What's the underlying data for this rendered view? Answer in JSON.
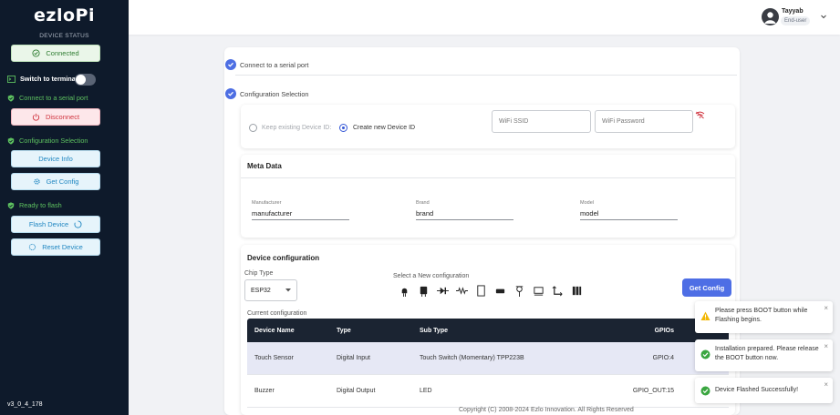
{
  "sidebar": {
    "logo": "ezloPi",
    "device_status": "DEVICE STATUS",
    "connected": "Connected",
    "switch_terminal": "Switch to terminal",
    "step1": "Connect to a serial port",
    "disconnect": "Disconnect",
    "step2": "Configuration Selection",
    "device_info": "Device Info",
    "get_config": "Get Config",
    "step3": "Ready to flash",
    "flash_device": "Flash Device",
    "reset_device": "Reset Device",
    "version": "v3_0_4_178"
  },
  "user": {
    "name": "Tayyab",
    "role": "End-user"
  },
  "steps": {
    "connect": "Connect to a serial port",
    "config": "Configuration Selection"
  },
  "device_id": {
    "keep": "Keep existing Device ID:",
    "create": "Create new Device ID",
    "wifi_ssid": "WiFi SSID",
    "wifi_password": "WiFi Password"
  },
  "meta": {
    "title": "Meta Data",
    "manufacturer_label": "Manufacturer",
    "manufacturer": "manufacturer",
    "brand_label": "Brand",
    "brand": "brand",
    "model_label": "Model",
    "model": "model"
  },
  "device_config": {
    "title": "Device configuration",
    "chip_type_label": "Chip Type",
    "chip_type": "ESP32",
    "new_config_label": "Select a New configuration",
    "get_config": "Get Config",
    "current_config_label": "Current configuration",
    "columns": [
      "Device Name",
      "Type",
      "Sub Type",
      "GPIOs"
    ],
    "rows": [
      [
        "Touch Sensor",
        "Digital Input",
        "Touch Switch (Momentary) TPP223B",
        "GPIO:4"
      ],
      [
        "Buzzer",
        "Digital Output",
        "LED",
        "GPIO_OUT:15"
      ]
    ]
  },
  "footer": "Copyright (C) 2008-2024 Ezlo Innovation. All Rights Reserved",
  "toasts": [
    {
      "text": "Please press BOOT button while Flashing begins.",
      "kind": "warning"
    },
    {
      "text": "Installation prepared. Please release the BOOT button now.",
      "kind": "success"
    },
    {
      "text": "Device Flashed Successfully!",
      "kind": "success"
    }
  ],
  "colors": {
    "sidebar": "#0e1a2b",
    "accent": "#4e6ee5",
    "success": "#3aa640",
    "warning": "#f2b705",
    "danger": "#d0343f"
  }
}
